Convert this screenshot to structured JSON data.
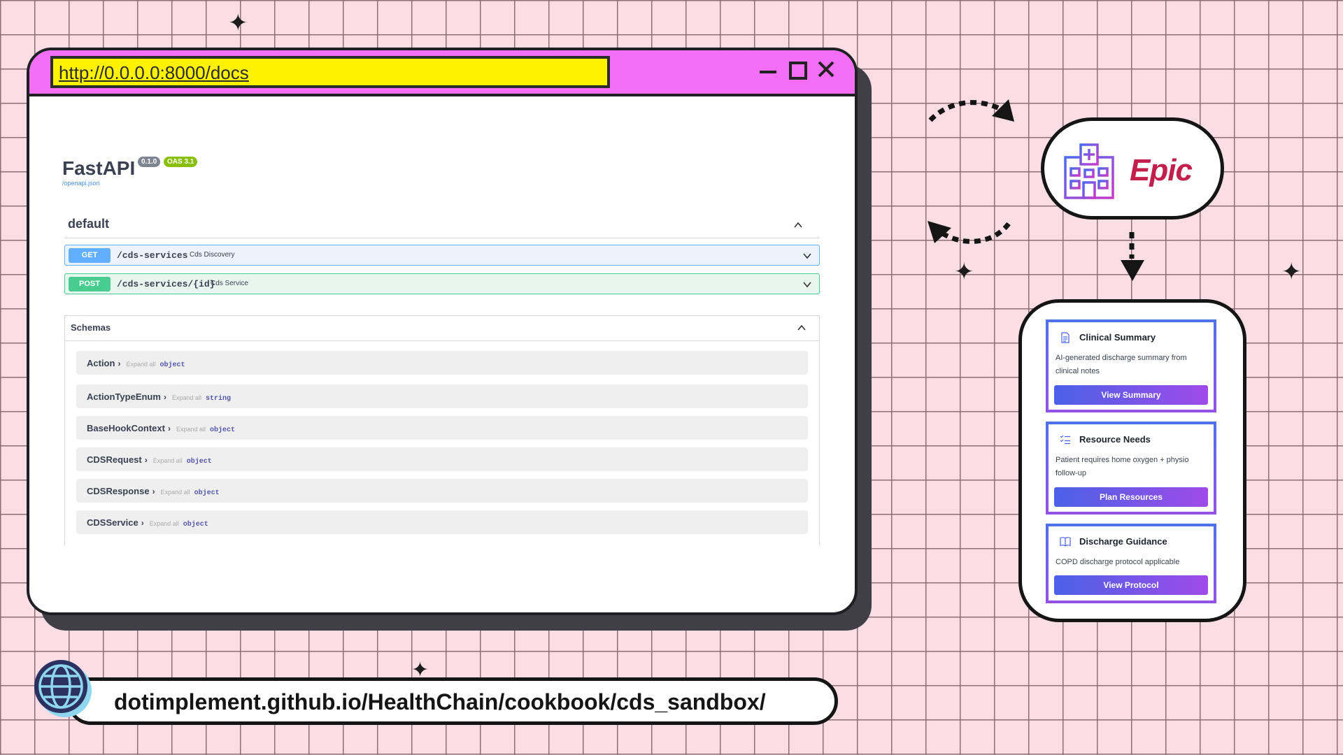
{
  "browser": {
    "url": "http://0.0.0.0:8000/docs"
  },
  "swagger": {
    "title": "FastAPI",
    "version_badge": "0.1.0",
    "oas_badge": "OAS 3.1",
    "openapi_link": "/openapi.json",
    "section_title": "default",
    "operations": [
      {
        "method": "GET",
        "path": "/cds-services",
        "summary": "Cds Discovery"
      },
      {
        "method": "POST",
        "path": "/cds-services/{id}",
        "summary": "Cds Service"
      }
    ],
    "schemas_title": "Schemas",
    "expand_label": "Expand all",
    "schemas": [
      {
        "name": "Action",
        "type": "object"
      },
      {
        "name": "ActionTypeEnum",
        "type": "string"
      },
      {
        "name": "BaseHookContext",
        "type": "object"
      },
      {
        "name": "CDSRequest",
        "type": "object"
      },
      {
        "name": "CDSResponse",
        "type": "object"
      },
      {
        "name": "CDSService",
        "type": "object"
      }
    ]
  },
  "epic": {
    "logo_text": "Epic",
    "icon": "hospital-icon"
  },
  "cards": [
    {
      "icon": "document-icon",
      "title": "Clinical Summary",
      "description": "AI-generated discharge summary from clinical notes",
      "button": "View Summary"
    },
    {
      "icon": "checklist-icon",
      "title": "Resource Needs",
      "description": "Patient requires home oxygen + physio follow-up",
      "button": "Plan Resources"
    },
    {
      "icon": "book-icon",
      "title": "Discharge Guidance",
      "description": "COPD discharge protocol applicable",
      "button": "View Protocol"
    }
  ],
  "footer": {
    "link": "dotimplement.github.io/HealthChain/cookbook/cds_sandbox/",
    "icon": "globe-icon"
  },
  "colors": {
    "background": "#fbdde6",
    "titlebar": "#f46ef7",
    "urlbar": "#fff200",
    "get": "#61affe",
    "post": "#49cc90",
    "epic": "#c31f4c"
  }
}
